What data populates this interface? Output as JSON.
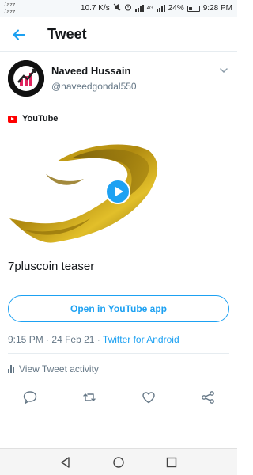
{
  "status_bar": {
    "carrier_line1": "Jazz",
    "carrier_line2": "Jazz",
    "speed": "10.7 K/s",
    "network": "4G",
    "battery": "24%",
    "time": "9:28 PM"
  },
  "header": {
    "title": "Tweet",
    "back_icon": "arrow-left-icon"
  },
  "tweet": {
    "author_name": "Naveed Hussain",
    "author_handle": "@naveedgondal550",
    "source_label": "YouTube",
    "video_title": "7pluscoin teaser",
    "open_button_label": "Open in YouTube app",
    "time": "9:15 PM",
    "date": "24 Feb 21",
    "client": "Twitter for Android",
    "activity_label": "View Tweet activity"
  },
  "colors": {
    "accent": "#1da1f2",
    "secondary_text": "#657786",
    "youtube_red": "#ff0000"
  },
  "icons": [
    "arrow-left-icon",
    "chevron-down-icon",
    "youtube-icon",
    "play-icon",
    "bar-chart-icon",
    "reply-icon",
    "retweet-icon",
    "like-icon",
    "share-icon",
    "nav-back-icon",
    "nav-home-icon",
    "nav-recents-icon"
  ]
}
